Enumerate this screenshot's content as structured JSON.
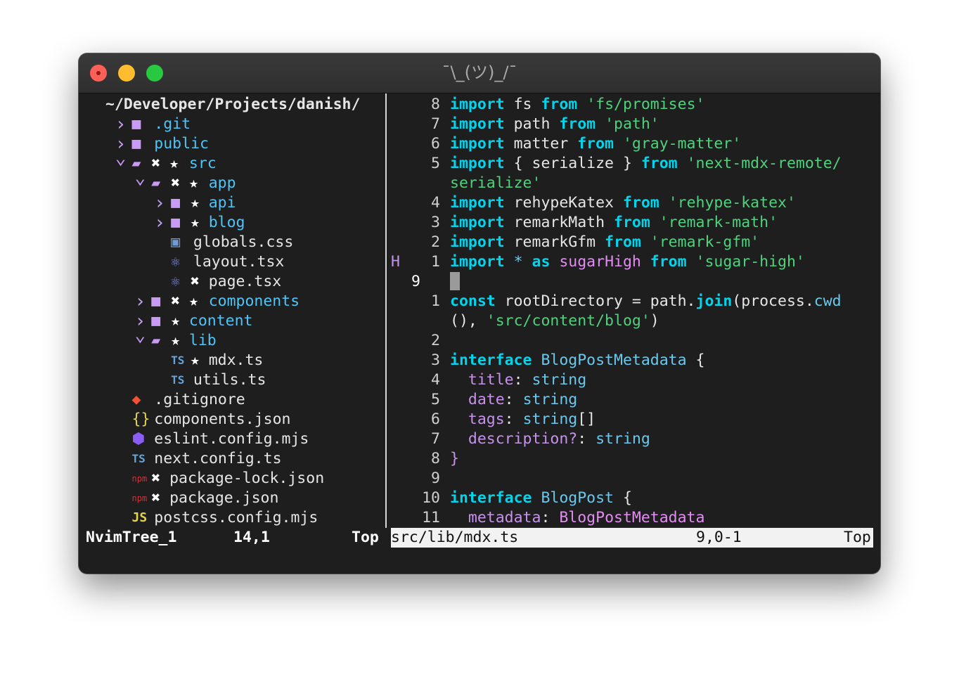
{
  "window": {
    "title": "¯\\_(ツ)_/¯",
    "colors": {
      "red": "#fe5f57",
      "yellow": "#febc2e",
      "green": "#28c840"
    }
  },
  "tree": {
    "root": "~/Developer/Projects/danish/",
    "items": [
      {
        "name": ".git",
        "type": "dir",
        "depth": 1,
        "chevron": ">",
        "icon": "folder-icon",
        "marks": ""
      },
      {
        "name": "public",
        "type": "dir",
        "depth": 1,
        "chevron": ">",
        "icon": "folder-icon",
        "marks": ""
      },
      {
        "name": "src",
        "type": "dir",
        "depth": 1,
        "chevron": "v",
        "icon": "folder-open-icon",
        "marks": "✖ ★"
      },
      {
        "name": "app",
        "type": "dir",
        "depth": 2,
        "chevron": "v",
        "icon": "folder-open-icon",
        "marks": "✖ ★"
      },
      {
        "name": "api",
        "type": "dir",
        "depth": 3,
        "chevron": ">",
        "icon": "folder-icon",
        "marks": "★"
      },
      {
        "name": "blog",
        "type": "dir",
        "depth": 3,
        "chevron": ">",
        "icon": "folder-icon",
        "marks": "★"
      },
      {
        "name": "globals.css",
        "type": "file",
        "depth": 3,
        "icon": "css-icon",
        "marks": ""
      },
      {
        "name": "layout.tsx",
        "type": "file",
        "depth": 3,
        "icon": "react-icon",
        "marks": ""
      },
      {
        "name": "page.tsx",
        "type": "file",
        "depth": 3,
        "icon": "react-icon",
        "marks": "✖"
      },
      {
        "name": "components",
        "type": "dir",
        "depth": 2,
        "chevron": ">",
        "icon": "folder-icon",
        "marks": "✖ ★"
      },
      {
        "name": "content",
        "type": "dir",
        "depth": 2,
        "chevron": ">",
        "icon": "folder-icon",
        "marks": "★"
      },
      {
        "name": "lib",
        "type": "dir",
        "depth": 2,
        "chevron": "v",
        "icon": "folder-open-icon",
        "marks": "★"
      },
      {
        "name": "mdx.ts",
        "type": "file",
        "depth": 3,
        "icon": "typescript-icon",
        "marks": "★"
      },
      {
        "name": "utils.ts",
        "type": "file",
        "depth": 3,
        "icon": "typescript-icon",
        "marks": ""
      },
      {
        "name": ".gitignore",
        "type": "file",
        "depth": 1,
        "icon": "git-icon",
        "marks": ""
      },
      {
        "name": "components.json",
        "type": "file",
        "depth": 1,
        "icon": "json-icon",
        "marks": ""
      },
      {
        "name": "eslint.config.mjs",
        "type": "file",
        "depth": 1,
        "icon": "eslint-icon",
        "marks": ""
      },
      {
        "name": "next.config.ts",
        "type": "file",
        "depth": 1,
        "icon": "typescript-icon",
        "marks": ""
      },
      {
        "name": "package-lock.json",
        "type": "file",
        "depth": 1,
        "icon": "npm-icon",
        "marks": "✖"
      },
      {
        "name": "package.json",
        "type": "file",
        "depth": 1,
        "icon": "npm-icon",
        "marks": "✖"
      },
      {
        "name": "postcss.config.mjs",
        "type": "file",
        "depth": 1,
        "icon": "javascript-icon",
        "marks": ""
      }
    ]
  },
  "code": {
    "sign_h": "H",
    "lines": [
      {
        "num": "8",
        "tokens": [
          [
            "kw",
            "import"
          ],
          [
            "",
            "fs "
          ],
          [
            "kw",
            "from"
          ],
          [
            "str",
            "'fs/promises'"
          ]
        ]
      },
      {
        "num": "7",
        "tokens": [
          [
            "kw",
            "import"
          ],
          [
            "",
            "path "
          ],
          [
            "kw",
            "from"
          ],
          [
            "str",
            "'path'"
          ]
        ]
      },
      {
        "num": "6",
        "tokens": [
          [
            "kw",
            "import"
          ],
          [
            "",
            "matter "
          ],
          [
            "kw",
            "from"
          ],
          [
            "str",
            "'gray-matter'"
          ]
        ]
      },
      {
        "num": "5",
        "tokens": [
          [
            "kw",
            "import"
          ],
          [
            "",
            "{ serialize } "
          ],
          [
            "kw",
            "from"
          ],
          [
            "str",
            "'next-mdx-remote/"
          ]
        ]
      },
      {
        "num": "",
        "tokens": [
          [
            "str",
            "serialize'"
          ]
        ]
      },
      {
        "num": "4",
        "tokens": [
          [
            "kw",
            "import"
          ],
          [
            "",
            "rehypeKatex "
          ],
          [
            "kw",
            "from"
          ],
          [
            "str",
            "'rehype-katex'"
          ]
        ]
      },
      {
        "num": "3",
        "tokens": [
          [
            "kw",
            "import"
          ],
          [
            "",
            "remarkMath "
          ],
          [
            "kw",
            "from"
          ],
          [
            "str",
            "'remark-math'"
          ]
        ]
      },
      {
        "num": "2",
        "tokens": [
          [
            "kw",
            "import"
          ],
          [
            "",
            "remarkGfm "
          ],
          [
            "kw",
            "from"
          ],
          [
            "str",
            "'remark-gfm'"
          ]
        ]
      },
      {
        "num": "1",
        "tokens": [
          [
            "kw",
            "import"
          ],
          [
            "ty",
            "* "
          ],
          [
            "kw",
            "as"
          ],
          [
            "purple",
            "sugarHigh "
          ],
          [
            "kw",
            "from"
          ],
          [
            "str",
            "'sugar-high'"
          ]
        ],
        "sign": true
      },
      {
        "num": "9",
        "current": true,
        "tokens": []
      },
      {
        "num": "1",
        "tokens": [
          [
            "kw",
            "const"
          ],
          [
            "",
            "rootDirectory = path."
          ],
          [
            "kw2",
            "join"
          ],
          [
            "",
            "(process."
          ],
          [
            "ty",
            "cwd"
          ]
        ]
      },
      {
        "num": "",
        "tokens": [
          [
            "",
            "(), "
          ],
          [
            "str",
            "'src/content/blog'"
          ],
          [
            "",
            ")"
          ]
        ]
      },
      {
        "num": "2",
        "tokens": []
      },
      {
        "num": "3",
        "tokens": [
          [
            "kw",
            "interface"
          ],
          [
            "ty",
            "BlogPostMetadata "
          ],
          [
            "",
            "{"
          ]
        ]
      },
      {
        "num": "4",
        "tokens": [
          [
            "prop",
            "  title"
          ],
          [
            "",
            ": "
          ],
          [
            "ty",
            "string"
          ]
        ]
      },
      {
        "num": "5",
        "tokens": [
          [
            "prop",
            "  date"
          ],
          [
            "",
            ": "
          ],
          [
            "ty",
            "string"
          ]
        ]
      },
      {
        "num": "6",
        "tokens": [
          [
            "prop",
            "  tags"
          ],
          [
            "",
            ": "
          ],
          [
            "ty",
            "string"
          ],
          [
            "",
            "[]"
          ]
        ]
      },
      {
        "num": "7",
        "tokens": [
          [
            "prop",
            "  description?"
          ],
          [
            "",
            ": "
          ],
          [
            "ty",
            "string"
          ]
        ]
      },
      {
        "num": "8",
        "tokens": [
          [
            "prop",
            "}"
          ]
        ]
      },
      {
        "num": "9",
        "tokens": []
      },
      {
        "num": "10",
        "tokens": [
          [
            "kw",
            "interface"
          ],
          [
            "ty",
            "BlogPost "
          ],
          [
            "",
            "{"
          ]
        ]
      },
      {
        "num": "11",
        "tokens": [
          [
            "prop",
            "  metadata"
          ],
          [
            "",
            ": "
          ],
          [
            "purple",
            "BlogPostMetadata"
          ]
        ]
      }
    ]
  },
  "status": {
    "left_name": "NvimTree_1",
    "left_pos": "14,1",
    "left_scroll": "Top",
    "right_file": "src/lib/mdx.ts",
    "right_pos": "9,0-1",
    "right_scroll": "Top"
  }
}
